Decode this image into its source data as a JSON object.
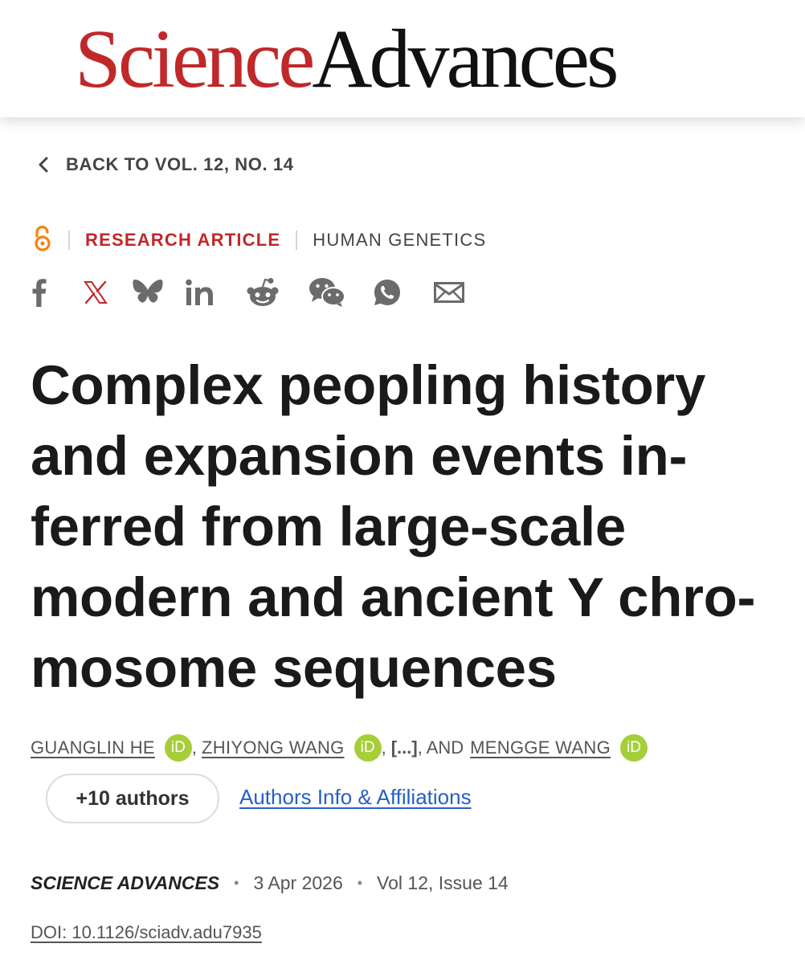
{
  "logo": {
    "science": "Science",
    "advances": "Advances"
  },
  "back_link": {
    "label": "BACK TO VOL. 12, NO. 14"
  },
  "article_meta": {
    "access_icon": "open-access-icon",
    "type": "RESEARCH ARTICLE",
    "subject": "HUMAN GENETICS"
  },
  "share": [
    {
      "icon": "facebook-icon"
    },
    {
      "icon": "x-icon"
    },
    {
      "icon": "bluesky-icon"
    },
    {
      "icon": "linkedin-icon"
    },
    {
      "icon": "reddit-icon"
    },
    {
      "icon": "wechat-icon"
    },
    {
      "icon": "whatsapp-icon"
    },
    {
      "icon": "email-icon"
    }
  ],
  "title": {
    "lines": [
      "Complex peopling history",
      "and expansion events in-",
      "ferred from large-scale",
      "modern and ancient Y chro-",
      "mosome sequences"
    ]
  },
  "authors": {
    "first": "GUANGLIN HE",
    "sep1": " ,",
    "second": "ZHIYONG WANG",
    "sep2": " ,",
    "ellipsis": "[...]",
    "sep3": " , AND",
    "last": "MENGGE WANG",
    "orcid_label": "iD",
    "more_button": "+10 authors",
    "affiliations_link": "Authors Info & Affiliations"
  },
  "publication": {
    "journal": "SCIENCE ADVANCES",
    "separator": "•",
    "date": "3 Apr 2026",
    "volume": "Vol 12, Issue 14",
    "doi": "DOI: 10.1126/sciadv.adu7935"
  },
  "colors": {
    "brand_red": "#c0282a",
    "link_blue": "#2760c4",
    "orcid_green": "#a6ce39",
    "icon_gray": "#6b6b6b"
  }
}
